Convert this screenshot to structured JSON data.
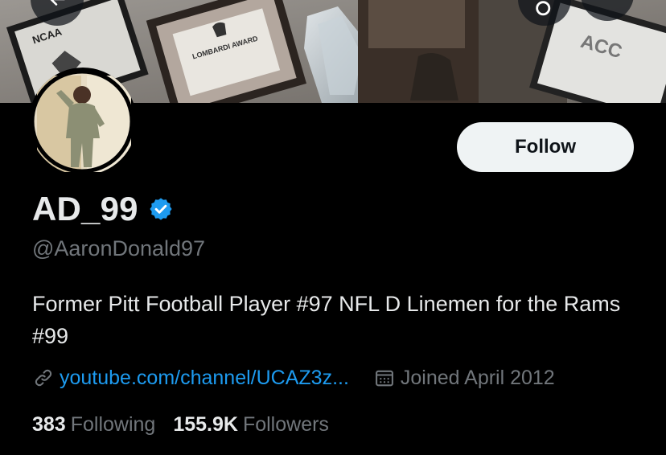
{
  "banner": {
    "plaque1_text": "NCAA",
    "plaque2_text": "LOMBARDI AWARD",
    "plaque3_text": "ACC"
  },
  "profile": {
    "display_name": "AD_99",
    "handle": "@AaronDonald97",
    "verified": true,
    "bio": "Former Pitt Football Player #97 NFL D Linemen for the Rams #99"
  },
  "actions": {
    "follow_label": "Follow"
  },
  "meta": {
    "link_text": "youtube.com/channel/UCAZ3z...",
    "joined_text": "Joined April 2012"
  },
  "stats": {
    "following_count": "383",
    "following_label": "Following",
    "followers_count": "155.9K",
    "followers_label": "Followers"
  },
  "colors": {
    "background": "#000000",
    "primary_text": "#e7e9ea",
    "secondary_text": "#71767b",
    "link": "#1d9bf0",
    "verified_badge": "#1d9bf0",
    "follow_button_bg": "#eff3f4"
  },
  "icons": [
    "back-arrow-icon",
    "search-icon",
    "more-icon",
    "verified-badge-icon",
    "link-icon",
    "calendar-icon"
  ]
}
